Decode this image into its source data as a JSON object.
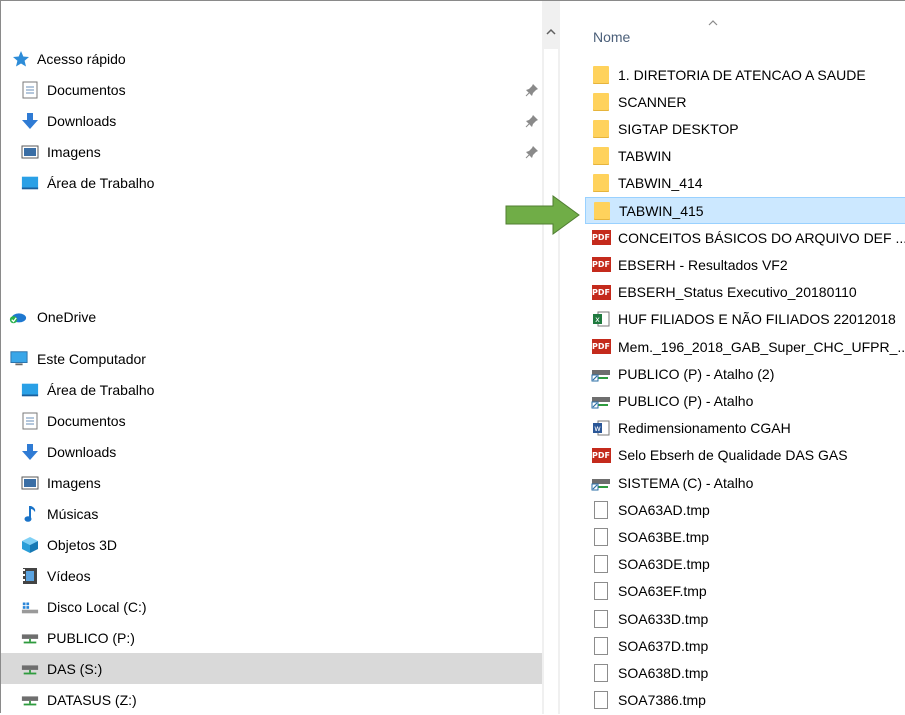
{
  "nav": {
    "items": [
      {
        "label": "Acesso rápido",
        "icon": "star-icon",
        "pinned": false
      },
      {
        "label": "Documentos",
        "icon": "document-icon",
        "pinned": true
      },
      {
        "label": "Downloads",
        "icon": "download-icon",
        "pinned": true
      },
      {
        "label": "Imagens",
        "icon": "images-icon",
        "pinned": true
      },
      {
        "label": "Área de Trabalho",
        "icon": "desktop-icon",
        "pinned": false
      },
      {
        "label": "OneDrive",
        "icon": "onedrive-icon",
        "pinned": false
      },
      {
        "label": "Este Computador",
        "icon": "computer-icon",
        "pinned": false
      },
      {
        "label": "Área de Trabalho",
        "icon": "desktop-icon",
        "pinned": false
      },
      {
        "label": "Documentos",
        "icon": "document-icon",
        "pinned": false
      },
      {
        "label": "Downloads",
        "icon": "download-icon",
        "pinned": false
      },
      {
        "label": "Imagens",
        "icon": "images-icon",
        "pinned": false
      },
      {
        "label": "Músicas",
        "icon": "music-icon",
        "pinned": false
      },
      {
        "label": "Objetos 3D",
        "icon": "cube-icon",
        "pinned": false
      },
      {
        "label": "Vídeos",
        "icon": "video-icon",
        "pinned": false
      },
      {
        "label": "Disco Local (C:)",
        "icon": "local-disk-icon",
        "pinned": false
      },
      {
        "label": "PUBLICO (P:)",
        "icon": "network-drive-icon",
        "pinned": false
      },
      {
        "label": "DAS (S:)",
        "icon": "network-drive-icon",
        "pinned": false,
        "selected": true
      },
      {
        "label": "DATASUS (Z:)",
        "icon": "network-drive-icon",
        "pinned": false
      }
    ]
  },
  "list": {
    "column_header": "Nome",
    "files": [
      {
        "name": "1. DIRETORIA DE ATENCAO A SAUDE",
        "icon": "folder-icon"
      },
      {
        "name": "SCANNER",
        "icon": "folder-icon"
      },
      {
        "name": "SIGTAP DESKTOP",
        "icon": "folder-icon"
      },
      {
        "name": "TABWIN",
        "icon": "folder-icon"
      },
      {
        "name": "TABWIN_414",
        "icon": "folder-icon"
      },
      {
        "name": "TABWIN_415",
        "icon": "folder-icon",
        "highlighted": true
      },
      {
        "name": "CONCEITOS BÁSICOS DO ARQUIVO DEF ...",
        "icon": "pdf-icon"
      },
      {
        "name": "EBSERH - Resultados VF2",
        "icon": "pdf-icon"
      },
      {
        "name": "EBSERH_Status Executivo_20180110",
        "icon": "pdf-icon"
      },
      {
        "name": "HUF FILIADOS  E NÃO FILIADOS 22012018",
        "icon": "excel-icon"
      },
      {
        "name": "Mem._196_2018_GAB_Super_CHC_UFPR_...",
        "icon": "pdf-icon"
      },
      {
        "name": "PUBLICO (P) - Atalho (2)",
        "icon": "shortcut-drive-icon"
      },
      {
        "name": "PUBLICO (P) - Atalho",
        "icon": "shortcut-drive-icon"
      },
      {
        "name": "Redimensionamento CGAH",
        "icon": "word-icon"
      },
      {
        "name": "Selo Ebserh de Qualidade DAS GAS",
        "icon": "pdf-icon"
      },
      {
        "name": "SISTEMA (C) - Atalho",
        "icon": "shortcut-drive-icon"
      },
      {
        "name": "SOA63AD.tmp",
        "icon": "blank-file-icon"
      },
      {
        "name": "SOA63BE.tmp",
        "icon": "blank-file-icon"
      },
      {
        "name": "SOA63DE.tmp",
        "icon": "blank-file-icon"
      },
      {
        "name": "SOA63EF.tmp",
        "icon": "blank-file-icon"
      },
      {
        "name": "SOA633D.tmp",
        "icon": "blank-file-icon"
      },
      {
        "name": "SOA637D.tmp",
        "icon": "blank-file-icon"
      },
      {
        "name": "SOA638D.tmp",
        "icon": "blank-file-icon"
      },
      {
        "name": "SOA7386.tmp",
        "icon": "blank-file-icon"
      }
    ]
  },
  "colors": {
    "selection_bg": "#cce8ff",
    "nav_selected_bg": "#d9d9d9",
    "folder": "#ffd25c",
    "pdf": "#c42a1c",
    "arrow": "#70ad47",
    "header_text": "#4c607a"
  }
}
